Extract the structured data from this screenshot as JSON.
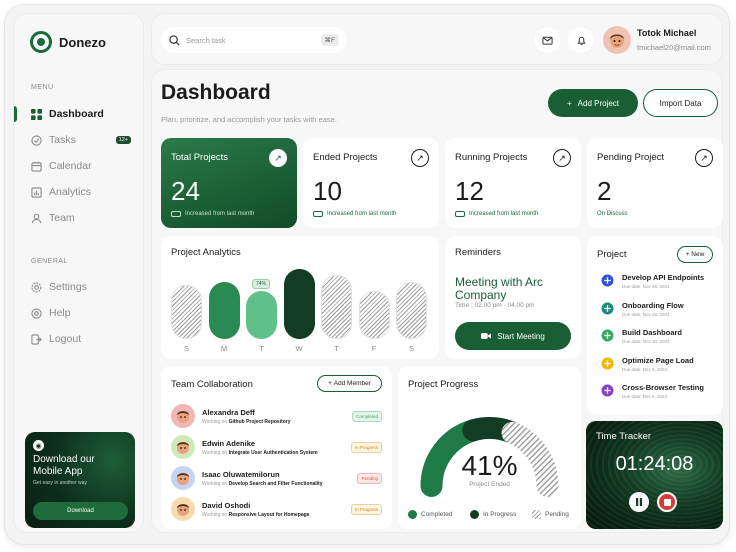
{
  "app": {
    "name": "Donezo"
  },
  "sidebar": {
    "menu_label": "MENU",
    "items": [
      {
        "label": "Dashboard",
        "icon": "grid-icon",
        "active": true
      },
      {
        "label": "Tasks",
        "icon": "tasks-icon",
        "badge": "12+"
      },
      {
        "label": "Calendar",
        "icon": "calendar-icon"
      },
      {
        "label": "Analytics",
        "icon": "analytics-icon"
      },
      {
        "label": "Team",
        "icon": "team-icon"
      }
    ],
    "general_label": "GENERAL",
    "general_items": [
      {
        "label": "Settings",
        "icon": "settings-icon"
      },
      {
        "label": "Help",
        "icon": "help-icon"
      },
      {
        "label": "Logout",
        "icon": "logout-icon"
      }
    ],
    "promo": {
      "title": "Download our Mobile App",
      "subtitle": "Get easy in another way",
      "button": "Download"
    }
  },
  "topbar": {
    "search_placeholder": "Search task",
    "shortcut": "⌘F",
    "user": {
      "name": "Totok Michael",
      "email": "tmichael20@mail.com"
    }
  },
  "header": {
    "title": "Dashboard",
    "subtitle": "Plan, prioritize, and accomplish your tasks with ease.",
    "add_project": "Add Project",
    "import_data": "Import Data"
  },
  "stats": [
    {
      "title": "Total Projects",
      "value": "24",
      "note": "Increased from last month"
    },
    {
      "title": "Ended Projects",
      "value": "10",
      "note": "Increased from last month"
    },
    {
      "title": "Running Projects",
      "value": "12",
      "note": "Increased from last month"
    },
    {
      "title": "Pending Project",
      "value": "2",
      "note": "On Discuss"
    }
  ],
  "analytics": {
    "title": "Project Analytics",
    "days": [
      "S",
      "M",
      "T",
      "W",
      "T",
      "F",
      "S"
    ],
    "levels": [
      0.77,
      0.82,
      0.68,
      1.0,
      0.91,
      0.68,
      0.82
    ],
    "tag": "74%"
  },
  "reminders": {
    "title": "Reminders",
    "meeting": "Meeting with Arc Company",
    "time": "Time : 02.00 pm - 04.00 pm",
    "button": "Start Meeting"
  },
  "projects": {
    "title": "Project",
    "new_label": "New",
    "items": [
      {
        "name": "Develop API Endpoints",
        "due": "Due date: Nov 26, 2024",
        "color": "#2f54d6"
      },
      {
        "name": "Onboarding Flow",
        "due": "Due date: Nov 28, 2024",
        "color": "#1e8a7a"
      },
      {
        "name": "Build Dashboard",
        "due": "Due date: Nov 30, 2024",
        "color": "#3aa86b"
      },
      {
        "name": "Optimize Page Load",
        "due": "Due date: Dec 5, 2024",
        "color": "#f2b705"
      },
      {
        "name": "Cross-Browser Testing",
        "due": "Due date: Dec 6, 2024",
        "color": "#8a3fc9"
      }
    ]
  },
  "team": {
    "title": "Team Collaboration",
    "add_member": "Add Member",
    "working_on": "Working on",
    "members": [
      {
        "name": "Alexandra Deff",
        "task": "Github Project Repository",
        "status": "Completed",
        "status_color": "#3aa86b",
        "status_bg": "#e6f4ea",
        "avatar_color": "#f3b5b5"
      },
      {
        "name": "Edwin Adenike",
        "task": "Integrate User Authentication System",
        "status": "In Progress",
        "status_color": "#c98a1a",
        "status_bg": "#fdf3e1",
        "avatar_color": "#cfe9b8"
      },
      {
        "name": "Isaac Oluwatemilorun",
        "task": "Develop Search and Filter Functionality",
        "status": "Pending",
        "status_color": "#d9534f",
        "status_bg": "#fbe7e6",
        "avatar_color": "#c8d3f2"
      },
      {
        "name": "David Oshodi",
        "task": "Responsive Layout for Homepage",
        "status": "In Progress",
        "status_color": "#c98a1a",
        "status_bg": "#fdf3e1",
        "avatar_color": "#f5dcae"
      }
    ]
  },
  "progress": {
    "title": "Project Progress",
    "percent": "41%",
    "percent_value": 41,
    "label": "Project Ended",
    "legend": [
      "Completed",
      "In Progress",
      "Pending"
    ]
  },
  "tracker": {
    "title": "Time Tracker",
    "time": "01:24:08"
  }
}
